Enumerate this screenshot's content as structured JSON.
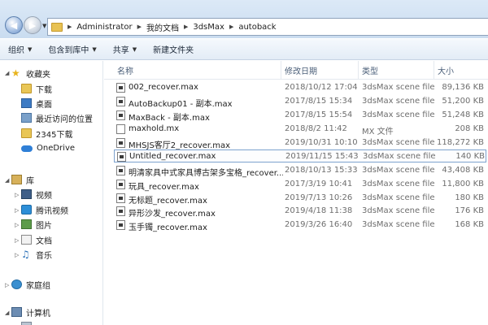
{
  "address_bar": {
    "crumbs": [
      "Administrator",
      "我的文档",
      "3dsMax",
      "autoback"
    ]
  },
  "toolbar": {
    "organize": "组织",
    "include_in_library": "包含到库中",
    "share": "共享",
    "new_folder": "新建文件夹"
  },
  "sidebar": {
    "favorites": "收藏夹",
    "downloads": "下载",
    "desktop": "桌面",
    "recent": "最近访问的位置",
    "downloads_2345": "2345下载",
    "onedrive": "OneDrive",
    "libraries": "库",
    "videos": "视频",
    "tencent_video": "腾讯视频",
    "pictures": "图片",
    "documents": "文档",
    "music": "音乐",
    "homegroup": "家庭组",
    "computer": "计算机"
  },
  "columns": {
    "name": "名称",
    "date": "修改日期",
    "type": "类型",
    "size": "大小"
  },
  "files": [
    {
      "name": "002_recover.max",
      "date": "2018/10/12 17:04",
      "type": "3dsMax scene file",
      "size": "89,136 KB"
    },
    {
      "name": "AutoBackup01 - 副本.max",
      "date": "2017/8/15 15:34",
      "type": "3dsMax scene file",
      "size": "51,200 KB"
    },
    {
      "name": "MaxBack - 副本.max",
      "date": "2017/8/15 15:54",
      "type": "3dsMax scene file",
      "size": "51,248 KB"
    },
    {
      "name": "maxhold.mx",
      "date": "2018/8/2 11:42",
      "type": "MX 文件",
      "size": "208 KB"
    },
    {
      "name": "MHSJS客厅2_recover.max",
      "date": "2019/10/31 10:10",
      "type": "3dsMax scene file",
      "size": "118,272 KB"
    },
    {
      "name": "Untitled_recover.max",
      "date": "2019/11/15 15:43",
      "type": "3dsMax scene file",
      "size": "140 KB"
    },
    {
      "name": "明清家具中式家具博古架多宝格_recover...",
      "date": "2018/10/13 15:33",
      "type": "3dsMax scene file",
      "size": "43,408 KB"
    },
    {
      "name": "玩具_recover.max",
      "date": "2017/3/19 10:41",
      "type": "3dsMax scene file",
      "size": "11,800 KB"
    },
    {
      "name": "无标题_recover.max",
      "date": "2019/7/13 10:26",
      "type": "3dsMax scene file",
      "size": "180 KB"
    },
    {
      "name": "异形沙发_recover.max",
      "date": "2019/4/18 11:38",
      "type": "3dsMax scene file",
      "size": "176 KB"
    },
    {
      "name": "玉手镯_recover.max",
      "date": "2019/3/26 16:40",
      "type": "3dsMax scene file",
      "size": "168 KB"
    }
  ]
}
